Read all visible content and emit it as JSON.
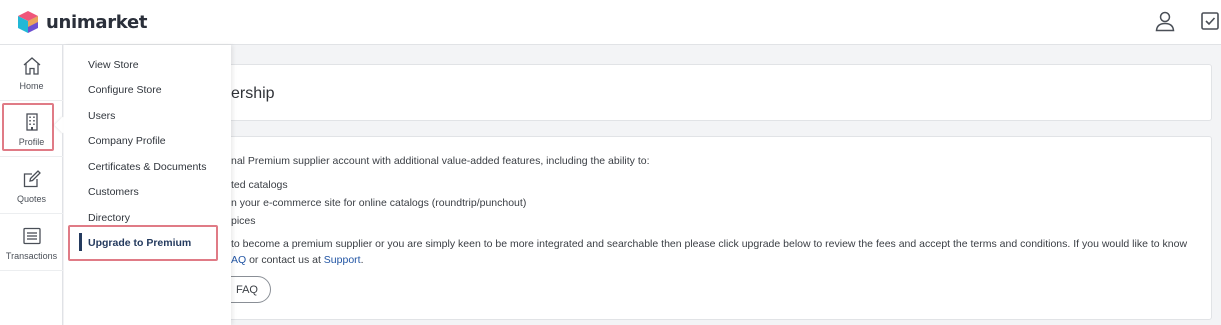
{
  "app": {
    "logo_text": "unimarket"
  },
  "rail": {
    "items": [
      {
        "label": "Home"
      },
      {
        "label": "Profile"
      },
      {
        "label": "Quotes"
      },
      {
        "label": "Transactions"
      }
    ]
  },
  "flyout": {
    "items": [
      {
        "label": "View Store"
      },
      {
        "label": "Configure Store"
      },
      {
        "label": "Users"
      },
      {
        "label": "Company Profile"
      },
      {
        "label": "Certificates & Documents"
      },
      {
        "label": "Customers"
      },
      {
        "label": "Directory"
      },
      {
        "label": "Upgrade to Premium"
      }
    ]
  },
  "main": {
    "title": "ership",
    "intro": "nal Premium supplier account with additional value-added features, including the ability to:",
    "bullets": [
      "ted catalogs",
      "n your e-commerce site for online catalogs (roundtrip/punchout)",
      "pices"
    ],
    "paragraph_line1": "to become a premium supplier or you are simply keen to be more integrated and searchable then please click upgrade below to review the fees and accept the terms and conditions. If you would like to know",
    "paragraph_line2_link1": "AQ",
    "paragraph_line2_mid": " or contact us at ",
    "paragraph_line2_link2": "Support",
    "paragraph_line2_end": ".",
    "faq_button": "FAQ"
  },
  "colors": {
    "accent": "#243a5e",
    "highlight": "#e07b86",
    "link": "#2255a4"
  }
}
